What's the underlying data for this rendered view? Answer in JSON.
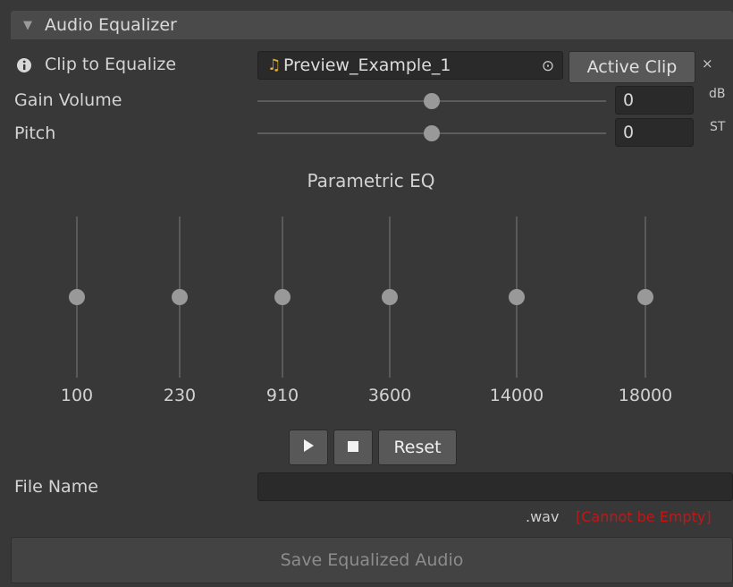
{
  "header": {
    "title": "Audio Equalizer",
    "collapse_icon": "triangle-down-icon"
  },
  "clip": {
    "label": "Clip to Equalize",
    "info_icon": "info-icon",
    "value": "Preview_Example_1",
    "note_icon": "music-note-icon",
    "active_clip_label": "Active Clip",
    "close_glyph": "×"
  },
  "gain": {
    "label": "Gain Volume",
    "value": "0",
    "unit": "dB",
    "level": 0.5
  },
  "pitch": {
    "label": "Pitch",
    "value": "0",
    "unit": "ST",
    "level": 0.5
  },
  "eq": {
    "title": "Parametric EQ",
    "bands": [
      {
        "freq": "100",
        "level": 0.5
      },
      {
        "freq": "230",
        "level": 0.5
      },
      {
        "freq": "910",
        "level": 0.5
      },
      {
        "freq": "3600",
        "level": 0.5
      },
      {
        "freq": "14000",
        "level": 0.5
      },
      {
        "freq": "18000",
        "level": 0.5
      }
    ]
  },
  "controls": {
    "play_icon": "play-icon",
    "stop_icon": "stop-icon",
    "reset_label": "Reset"
  },
  "file": {
    "label": "File Name",
    "value": "",
    "extension": ".wav",
    "error": "[Cannot be Empty]"
  },
  "save": {
    "label": "Save Equalized Audio"
  },
  "colors": {
    "background": "#383838",
    "field": "#2a2a2a",
    "button": "#585858",
    "error": "#c81414",
    "note": "#e2b030"
  }
}
